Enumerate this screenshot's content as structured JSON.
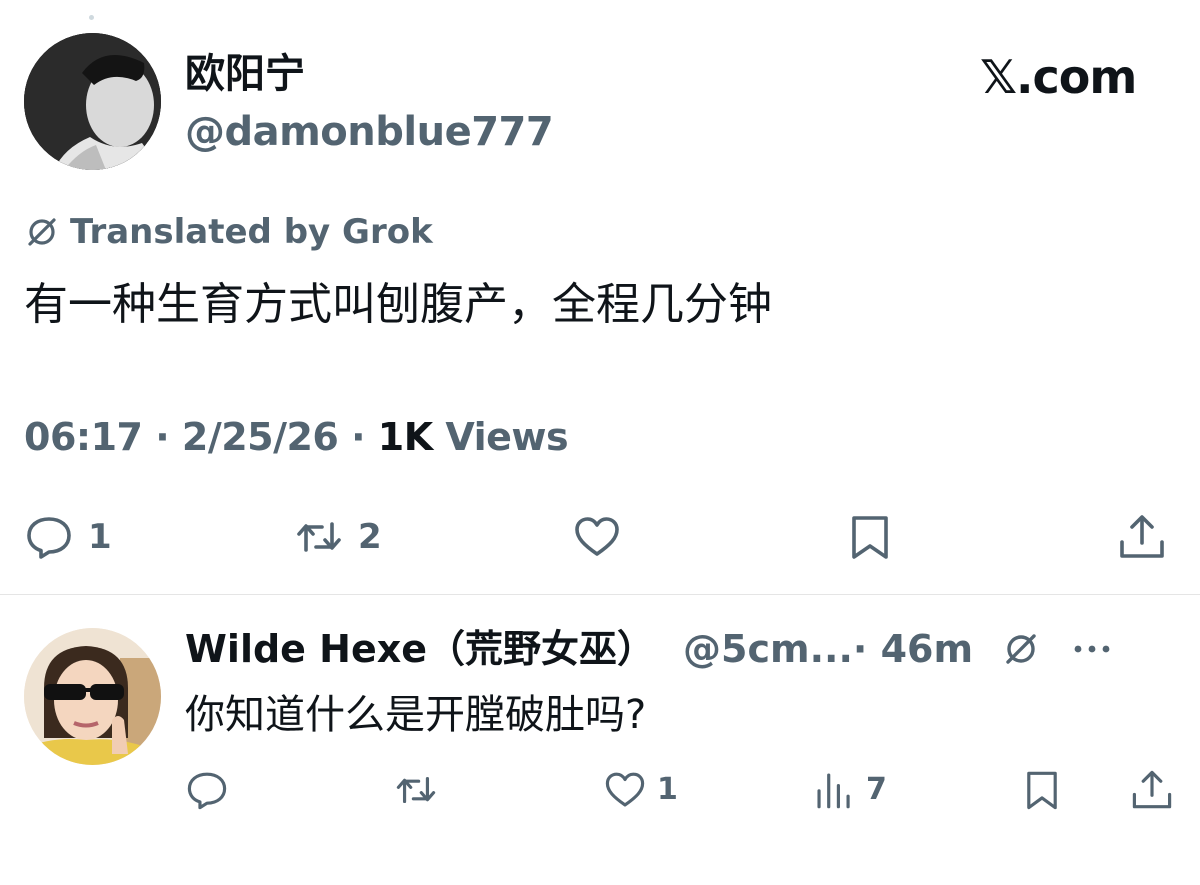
{
  "post": {
    "author": {
      "display_name": "欧阳宁",
      "handle": "@damonblue777"
    },
    "brand": "𝕏.com",
    "translated_label": "Translated by Grok",
    "text": "有一种生育方式叫刨腹产，全程几分钟",
    "time": "06:17",
    "date": "2/25/26",
    "views_count": "1K",
    "views_label": "Views",
    "actions": {
      "reply_count": "1",
      "repost_count": "2"
    }
  },
  "reply": {
    "display_name": "Wilde Hexe（荒野女巫）",
    "handle": "@5cm...",
    "time": "· 46m",
    "text": "你知道什么是开膛破肚吗?",
    "actions": {
      "like_count": "1",
      "views_count": "7"
    }
  },
  "icons": {
    "grok": "grok-icon",
    "reply": "reply-icon",
    "repost": "repost-icon",
    "like": "heart-icon",
    "bookmark": "bookmark-icon",
    "share": "share-icon",
    "views": "views-icon",
    "more": "more-icon"
  },
  "colors": {
    "text_primary": "#0f1419",
    "text_secondary": "#536471",
    "divider": "#e5e5e5"
  }
}
